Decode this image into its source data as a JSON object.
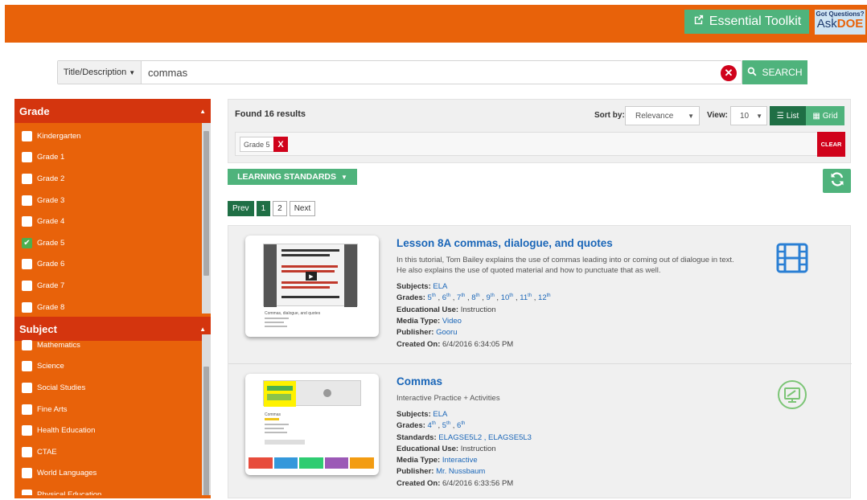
{
  "header": {
    "toolkit_label": "Essential Toolkit",
    "askdoe_top": "Got Questions?",
    "askdoe_ask": "Ask",
    "askdoe_doe": "DOE"
  },
  "search": {
    "type_label": "Title/Description",
    "value": "commas",
    "button_label": "SEARCH"
  },
  "facets": {
    "grade": {
      "title": "Grade",
      "items": [
        {
          "label": "Kindergarten",
          "checked": false
        },
        {
          "label": "Grade 1",
          "checked": false
        },
        {
          "label": "Grade 2",
          "checked": false
        },
        {
          "label": "Grade 3",
          "checked": false
        },
        {
          "label": "Grade 4",
          "checked": false
        },
        {
          "label": "Grade 5",
          "checked": true
        },
        {
          "label": "Grade 6",
          "checked": false
        },
        {
          "label": "Grade 7",
          "checked": false
        },
        {
          "label": "Grade 8",
          "checked": false
        }
      ]
    },
    "subject": {
      "title": "Subject",
      "items": [
        {
          "label": "Mathematics",
          "checked": false
        },
        {
          "label": "Science",
          "checked": false
        },
        {
          "label": "Social Studies",
          "checked": false
        },
        {
          "label": "Fine Arts",
          "checked": false
        },
        {
          "label": "Health Education",
          "checked": false
        },
        {
          "label": "CTAE",
          "checked": false
        },
        {
          "label": "World Languages",
          "checked": false
        },
        {
          "label": "Physical Education",
          "checked": false
        }
      ]
    }
  },
  "results_bar": {
    "found": "Found 16 results",
    "sort_label": "Sort by:",
    "sort_value": "Relevance",
    "view_label": "View:",
    "view_value": "10",
    "list_label": "List",
    "grid_label": "Grid",
    "chip_label": "Grade 5",
    "chip_remove": "X",
    "clear_label": "CLEAR"
  },
  "learning_standards_label": "LEARNING STANDARDS",
  "pagination": {
    "prev": "Prev",
    "pages": [
      "1",
      "2"
    ],
    "next": "Next"
  },
  "results": [
    {
      "title": "Lesson 8A commas, dialogue, and quotes",
      "description": "In this tutorial, Tom Bailey explains the use of commas leading into or coming out of dialogue in text. He also explains the use of quoted material and how to punctuate that as well.",
      "subjects_label": "Subjects:",
      "subjects": "ELA",
      "grades_label": "Grades:",
      "grades": [
        "5",
        "6",
        "7",
        "8",
        "9",
        "10",
        "11",
        "12"
      ],
      "grade_suffix": "th",
      "edu_label": "Educational Use:",
      "edu": "Instruction",
      "media_label": "Media Type:",
      "media": "Video",
      "publisher_label": "Publisher:",
      "publisher": "Gooru",
      "created_label": "Created On:",
      "created": "6/4/2016 6:34:05 PM",
      "type_icon": "film-icon",
      "icon_color": "#2a7fd4"
    },
    {
      "title": "Commas",
      "description": "Interactive Practice + Activities",
      "subjects_label": "Subjects:",
      "subjects": "ELA",
      "grades_label": "Grades:",
      "grades": [
        "4",
        "5",
        "6"
      ],
      "grade_suffix": "th",
      "standards_label": "Standards:",
      "standards": "ELAGSE5L2 , ELAGSE5L3",
      "edu_label": "Educational Use:",
      "edu": "Instruction",
      "media_label": "Media Type:",
      "media": "Interactive",
      "publisher_label": "Publisher:",
      "publisher": "Mr. Nussbaum",
      "created_label": "Created On:",
      "created": "6/4/2016 6:33:56 PM",
      "type_icon": "interactive-icon",
      "icon_color": "#7cc576"
    }
  ],
  "thumb_texts": {
    "r1_caption": "Commas, dialogue, and quotes",
    "r2_caption": "Commas"
  }
}
